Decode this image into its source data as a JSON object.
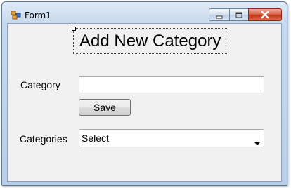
{
  "window": {
    "title": "Form1"
  },
  "form": {
    "heading": "Add New Category",
    "category_label": "Category",
    "category_value": "",
    "save_label": "Save",
    "categories_label": "Categories",
    "categories_selected": "Select"
  },
  "icons": {
    "app": "windows-form-icon",
    "minimize": "minimize-icon",
    "maximize": "maximize-icon",
    "close": "close-icon",
    "dropdown": "chevron-down-icon"
  }
}
